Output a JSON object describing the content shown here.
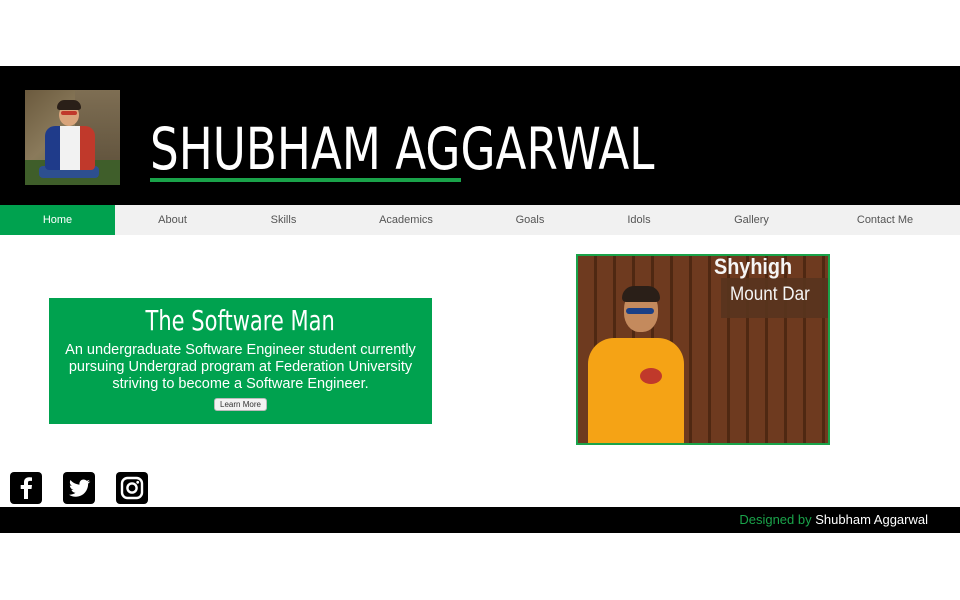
{
  "header": {
    "title": "SHUBHAM AGGARWAL",
    "accent": "#1aa34a",
    "avatar_icon": "profile-photo"
  },
  "nav": {
    "items": [
      {
        "label": "Home",
        "active": true
      },
      {
        "label": "About"
      },
      {
        "label": "Skills"
      },
      {
        "label": "Academics"
      },
      {
        "label": "Goals"
      },
      {
        "label": "Idols"
      },
      {
        "label": "Gallery"
      },
      {
        "label": "Contact Me"
      }
    ],
    "active_color": "#00a24f"
  },
  "hero": {
    "title": "The Software Man",
    "description": "An undergraduate Software Engineer student currently pursuing Undergrad program at Federation University striving to become a Software Engineer.",
    "button_label": "Learn More"
  },
  "photo": {
    "sign_top": "Shyhigh",
    "sign_text": "Mount Dar"
  },
  "socials": [
    {
      "icon": "facebook-icon"
    },
    {
      "icon": "twitter-icon"
    },
    {
      "icon": "instagram-icon"
    }
  ],
  "footer": {
    "designed_by": "Designed by",
    "author": "Shubham Aggarwal"
  }
}
